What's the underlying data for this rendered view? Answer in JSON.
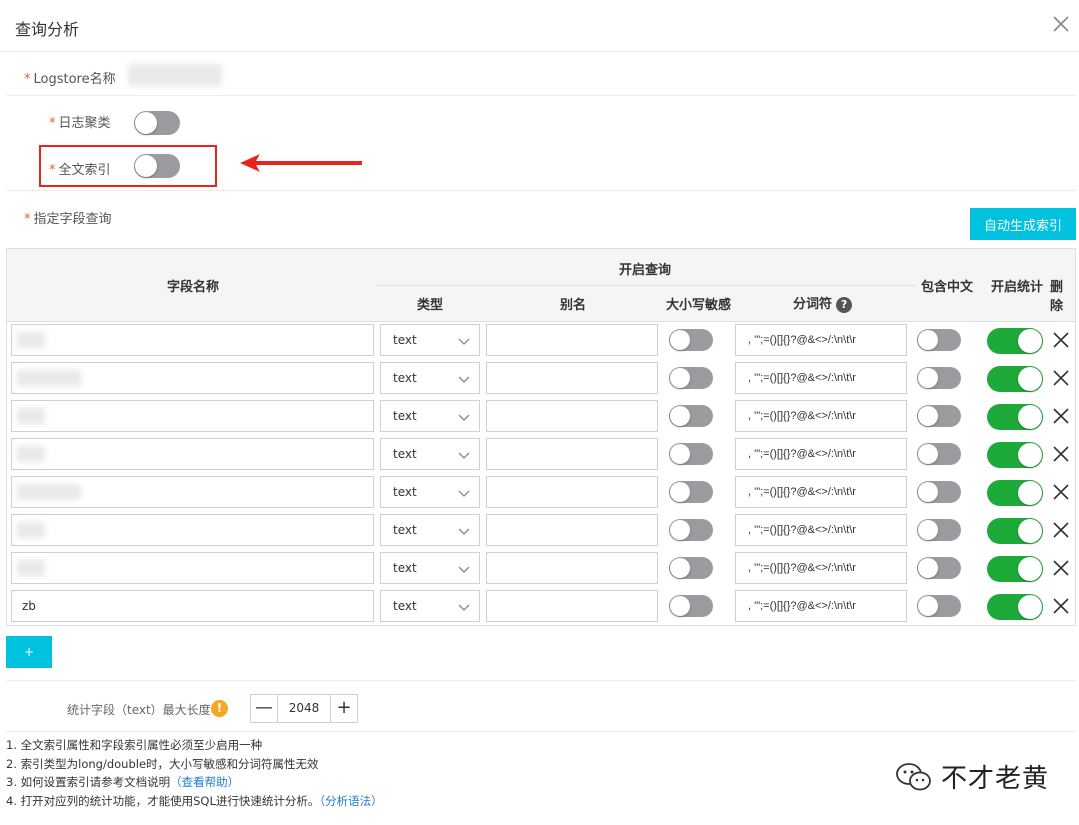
{
  "dialog": {
    "title": "查询分析"
  },
  "logstore": {
    "label": "Logstore名称"
  },
  "log_cluster": {
    "label": "日志聚类",
    "enabled": false
  },
  "fulltext_index": {
    "label": "全文索引",
    "enabled": false
  },
  "field_query": {
    "label": "指定字段查询"
  },
  "auto_index_button": "自动生成索引",
  "table": {
    "headers": {
      "field_name": "字段名称",
      "enable_query": "开启查询",
      "type": "类型",
      "alias": "别名",
      "case_sensitive": "大小写敏感",
      "tokenizer": "分词符",
      "include_chinese": "包含中文",
      "enable_stats": "开启统计",
      "delete": "删除"
    },
    "tokenizer_help_icon": "?",
    "rows": [
      {
        "field": "",
        "type": "text",
        "alias": "",
        "case_sensitive": false,
        "tokenizer": ", '\";=()[]{}?@&<>/:\\n\\t\\r",
        "include_chinese": false,
        "stats": true
      },
      {
        "field": "",
        "type": "text",
        "alias": "",
        "case_sensitive": false,
        "tokenizer": ", '\";=()[]{}?@&<>/:\\n\\t\\r",
        "include_chinese": false,
        "stats": true
      },
      {
        "field": "",
        "type": "text",
        "alias": "",
        "case_sensitive": false,
        "tokenizer": ", '\";=()[]{}?@&<>/:\\n\\t\\r",
        "include_chinese": false,
        "stats": true
      },
      {
        "field": "",
        "type": "text",
        "alias": "",
        "case_sensitive": false,
        "tokenizer": ", '\";=()[]{}?@&<>/:\\n\\t\\r",
        "include_chinese": false,
        "stats": true
      },
      {
        "field": "",
        "type": "text",
        "alias": "",
        "case_sensitive": false,
        "tokenizer": ", '\";=()[]{}?@&<>/:\\n\\t\\r",
        "include_chinese": false,
        "stats": true
      },
      {
        "field": "",
        "type": "text",
        "alias": "",
        "case_sensitive": false,
        "tokenizer": ", '\";=()[]{}?@&<>/:\\n\\t\\r",
        "include_chinese": false,
        "stats": true
      },
      {
        "field": "",
        "type": "text",
        "alias": "",
        "case_sensitive": false,
        "tokenizer": ", '\";=()[]{}?@&<>/:\\n\\t\\r",
        "include_chinese": false,
        "stats": true
      },
      {
        "field": "zb",
        "type": "text",
        "alias": "",
        "case_sensitive": false,
        "tokenizer": ", '\";=()[]{}?@&<>/:\\n\\t\\r",
        "include_chinese": false,
        "stats": true
      }
    ]
  },
  "add_button": "+",
  "stat_field": {
    "label": "统计字段（text）最大长度",
    "value": "2048",
    "warn_icon": "!",
    "minus": "—",
    "plus": "+"
  },
  "notes": [
    {
      "text": "1. 全文索引属性和字段索引属性必须至少启用一种",
      "link": ""
    },
    {
      "text": "2. 索引类型为long/double时，大小写敏感和分词符属性无效",
      "link": ""
    },
    {
      "text": "3. 如何设置索引请参考文档说明",
      "link": "（查看帮助）"
    },
    {
      "text": "4. 打开对应列的统计功能，才能使用SQL进行快速统计分析。",
      "link": "（分析语法）"
    }
  ],
  "watermark": {
    "text": "不才老黄"
  },
  "colors": {
    "accent": "#00c1de",
    "toggle_on": "#1eaa39",
    "toggle_off": "#999b9e",
    "highlight": "#e8251d"
  }
}
